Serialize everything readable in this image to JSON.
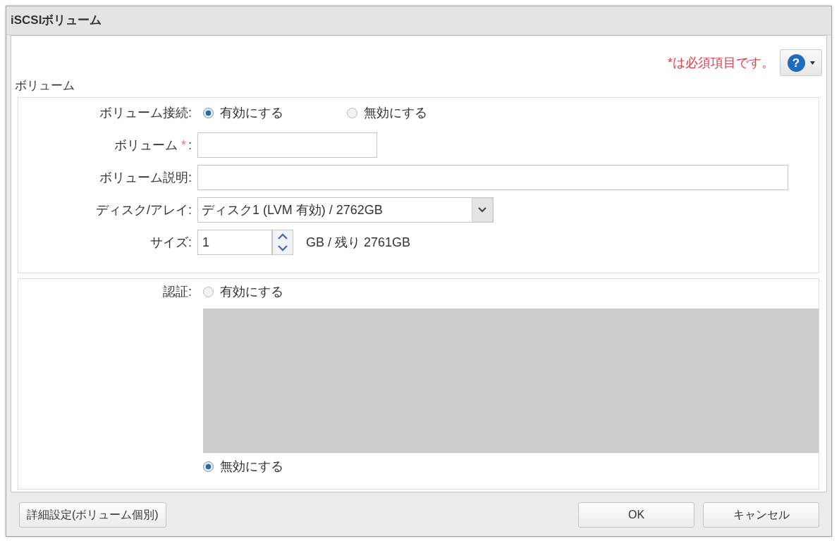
{
  "window": {
    "title": "iSCSIボリューム"
  },
  "required_note": "*は必須項目です。",
  "help_button": {
    "label": "?"
  },
  "volume_section": {
    "title": "ボリューム",
    "fields": [
      {
        "kind": "radio",
        "label": "ボリューム接続:",
        "options": [
          {
            "label": "有効にする",
            "selected": true
          },
          {
            "label": "無効にする",
            "selected": false
          }
        ]
      },
      {
        "kind": "text",
        "label": "ボリューム",
        "required_mark": "*",
        "label_suffix": ":"
      },
      {
        "kind": "wide_text",
        "label": "ボリューム説明:"
      },
      {
        "kind": "select",
        "label": "ディスク/アレイ:",
        "value": "ディスク1 (LVM 有効) / 2762GB"
      },
      {
        "kind": "spinner",
        "label": "サイズ:",
        "value": "1",
        "unit": "GB / 残り 2761GB"
      }
    ]
  },
  "auth_section": {
    "label": "認証:",
    "options": [
      {
        "label": "有効にする",
        "selected": false
      },
      {
        "label": "無効にする",
        "selected": true
      }
    ]
  },
  "footer": {
    "left_button": "詳細設定(ボリューム個別)",
    "buttons": [
      "OK",
      "キャンセル"
    ]
  }
}
